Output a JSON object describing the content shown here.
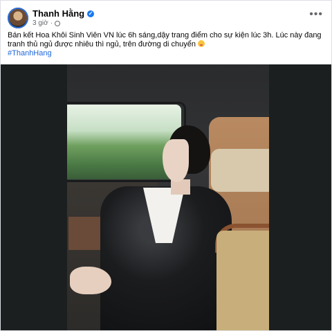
{
  "post": {
    "author": "Thanh Hằng",
    "time": "3 giờ",
    "separator": "·",
    "more_label": "•••",
    "text": "Bán kết Hoa Khôi Sinh Viên VN lúc 6h sáng,dậy trang điểm cho sự kiện lúc 3h. Lúc này đang tranh thủ ngủ được nhiêu thì ngủ, trên đường di chuyển",
    "hashtag": "#ThanhHang"
  },
  "colors": {
    "accent": "#1877f2",
    "hashtag": "#1d66d8",
    "meta": "#65676b"
  },
  "icons": {
    "verified": "verified-badge-icon",
    "privacy": "globe-icon",
    "emoji": "smiling-emoji-icon"
  }
}
